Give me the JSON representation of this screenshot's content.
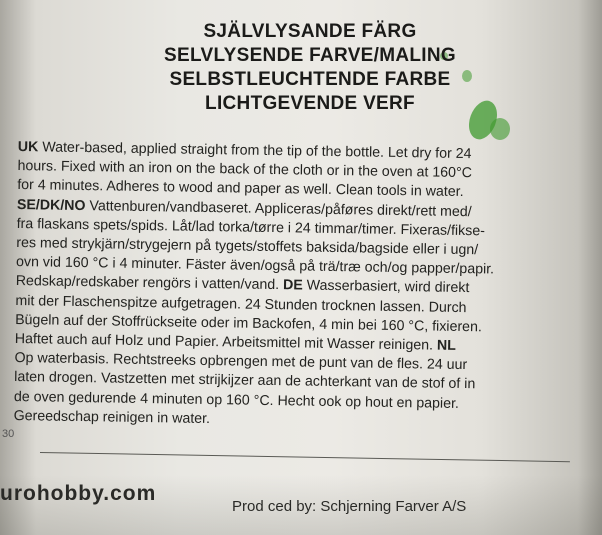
{
  "headings": [
    "SJÄLVLYSANDE FÄRG",
    "SELVLYSENDE FARVE/MALING",
    "SELBSTLEUCHTENDE FARBE",
    "LICHTGEVENDE VERF"
  ],
  "body_lines": [
    [
      {
        "t": "UK",
        "b": true
      },
      {
        "t": " Water-based, applied straight from the tip of the bottle. Let dry for 24",
        "b": false
      }
    ],
    [
      {
        "t": "hours. Fixed with an iron on the back of the cloth or in the oven at 160°C",
        "b": false
      }
    ],
    [
      {
        "t": "for 4 minutes. Adheres to wood and paper as well. Clean tools in water.",
        "b": false
      }
    ],
    [
      {
        "t": "SE/DK/NO",
        "b": true
      },
      {
        "t": " Vattenburen/vandbaseret. Appliceras/påføres direkt/rett med/",
        "b": false
      }
    ],
    [
      {
        "t": "fra flaskans spets/spids. Låt/lad torka/tørre i 24 timmar/timer. Fixeras/fikse-",
        "b": false
      }
    ],
    [
      {
        "t": "res med strykjärn/strygejern på tygets/stoffets baksida/bagside eller i ugn/",
        "b": false
      }
    ],
    [
      {
        "t": "ovn vid 160 °C i 4 minuter. Fäster även/også på trä/træ och/og papper/papir.",
        "b": false
      }
    ],
    [
      {
        "t": "Redskap/redskaber rengörs i vatten/vand.",
        "b": false
      },
      {
        "t": " DE",
        "b": true
      },
      {
        "t": " Wasserbasiert, wird direkt",
        "b": false
      }
    ],
    [
      {
        "t": "mit der Flaschenspitze aufgetragen. 24 Stunden trocknen lassen. Durch",
        "b": false
      }
    ],
    [
      {
        "t": "Bügeln auf der Stoffrückseite oder im Backofen, 4 min bei 160 °C, fixieren.",
        "b": false
      }
    ],
    [
      {
        "t": "Haftet auch auf Holz und Papier. Arbeitsmittel mit Wasser reinigen.",
        "b": false
      },
      {
        "t": " NL",
        "b": true
      }
    ],
    [
      {
        "t": "Op waterbasis. Rechtstreeks opbrengen met de punt van de fles. 24 uur",
        "b": false
      }
    ],
    [
      {
        "t": "laten drogen. Vastzetten met strijkijzer aan de achterkant van de stof of in",
        "b": false
      }
    ],
    [
      {
        "t": "de oven gedurende 4 minuten op 160 °C. Hecht ook op hout en papier.",
        "b": false
      }
    ],
    [
      {
        "t": "Gereedschap reinigen in water.",
        "b": false
      }
    ]
  ],
  "footer": {
    "website": "urohobby.com",
    "producer": "Prod   ced by: Schjerning Farver A/S"
  },
  "edge_mark": "30"
}
